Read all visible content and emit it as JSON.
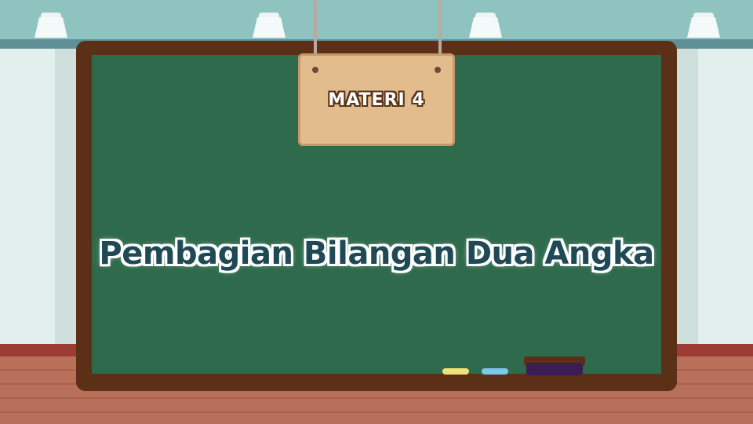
{
  "sign": {
    "label": "MATERI 4"
  },
  "board": {
    "title": "Pembagian Bilangan Dua Angka"
  },
  "colors": {
    "board": "#2e6a4b",
    "frame": "#5b3016",
    "sign": "#e2bc8d",
    "title_text": "#1f4a55",
    "wall": "#cfe0dc"
  }
}
